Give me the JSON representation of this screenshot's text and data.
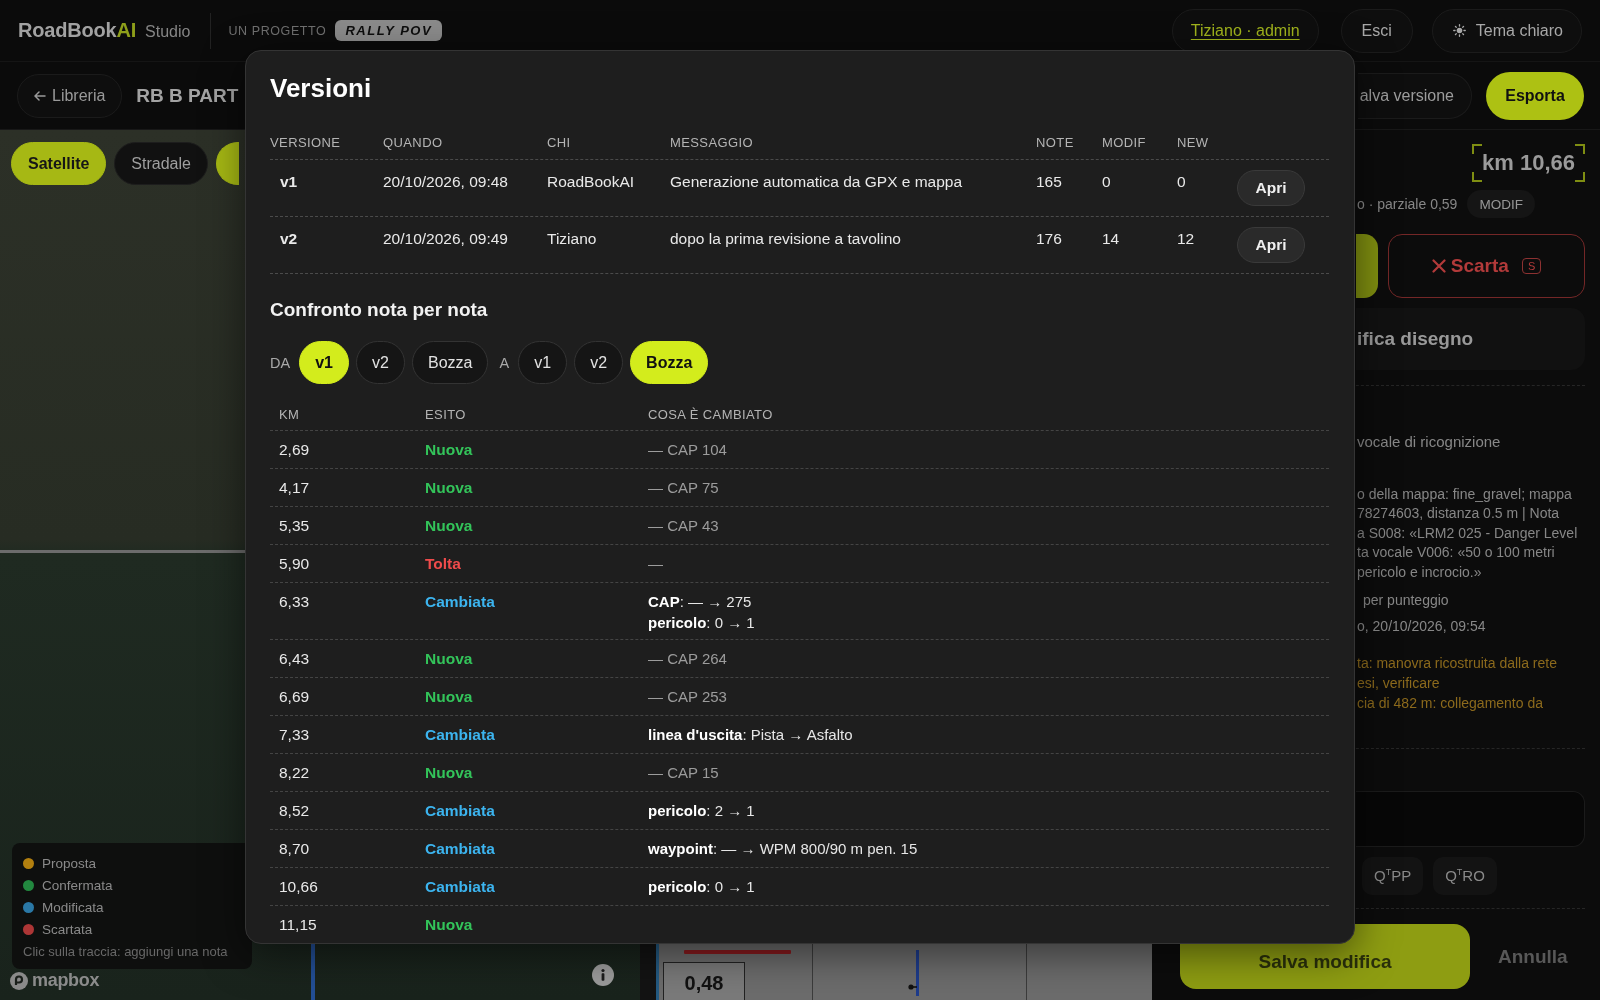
{
  "header": {
    "brand": {
      "name": "RoadBook",
      "accent": "AI",
      "product": "Studio"
    },
    "project_label": "UN PROGETTO",
    "partner_logo": "RALLY POV",
    "user_link": "Tiziano · admin",
    "logout_button": "Esci",
    "theme_button": "Tema chiaro"
  },
  "toolbar": {
    "back_button": "Libreria",
    "title": "RB B PART",
    "save_version_button": "alva versione",
    "export_button": "Esporta"
  },
  "map": {
    "layers": [
      {
        "label": "Satellite",
        "selected": true
      },
      {
        "label": "Stradale",
        "selected": false
      }
    ],
    "tool_button": {
      "active": true
    },
    "legend": [
      {
        "label": "Proposta",
        "color": "#b3800f"
      },
      {
        "label": "Confermata",
        "color": "#22883f"
      },
      {
        "label": "Modificata",
        "color": "#2a78a6"
      },
      {
        "label": "Scartata",
        "color": "#ad3636"
      }
    ],
    "legend_hint": "Clic sulla traccia: aggiungi una nota",
    "attribution": "mapbox"
  },
  "roadbook": {
    "distance": "0,48"
  },
  "note_panel": {
    "km": "km 10,66",
    "partial": "o · parziale 0,59",
    "status_badge": "MODIF",
    "discard_button": {
      "label": "Scarta",
      "shortcut": "S"
    },
    "edit_drawing_button": "ifica disegno",
    "source": "vocale di ricognizione",
    "description_lines": [
      "o della mappa: fine_gravel; mappa",
      "78274603, distanza 0.5 m | Nota",
      "a S008: «LRM2 025 - Danger Level",
      "ta vocale V006: «50 o 100 metri",
      "pericolo e incrocio.»"
    ],
    "score_note": "per punteggio",
    "timestamp": "o, 20/10/2026, 09:54",
    "warnings": [
      "ta: manovra ricostruita dalla rete",
      "esi, verificare",
      "cia di 482 m: collegamento da"
    ],
    "quick_buttons": [
      "Q$^{T}$PP",
      "Q$^{T}$RO"
    ],
    "save_button": "Salva modifica",
    "cancel_button": "Annulla"
  },
  "versions_dialog": {
    "title": "Versioni",
    "columns": [
      "VERSIONE",
      "QUANDO",
      "CHI",
      "MESSAGGIO",
      "NOTE",
      "MODIF",
      "NEW"
    ],
    "rows": [
      {
        "version": "v1",
        "when": "20/10/2026, 09:48",
        "who": "RoadBookAI",
        "message": "Generazione automatica da GPX e mappa",
        "notes": "165",
        "modified": "0",
        "new": "0",
        "action": "Apri"
      },
      {
        "version": "v2",
        "when": "20/10/2026, 09:49",
        "who": "Tiziano",
        "message": "dopo la prima revisione a tavolino",
        "notes": "176",
        "modified": "14",
        "new": "12",
        "action": "Apri"
      }
    ],
    "compare": {
      "title": "Confronto nota per nota",
      "from": {
        "label": "DA",
        "options": [
          {
            "label": "v1",
            "selected": true
          },
          {
            "label": "v2",
            "selected": false
          },
          {
            "label": "Bozza",
            "selected": false
          }
        ]
      },
      "to": {
        "label": "A",
        "options": [
          {
            "label": "v1",
            "selected": false
          },
          {
            "label": "v2",
            "selected": false
          },
          {
            "label": "Bozza",
            "selected": true
          }
        ]
      },
      "columns": [
        "KM",
        "ESITO",
        "COSA È CAMBIATO"
      ],
      "rows": [
        {
          "km": "2,69",
          "kind": "new",
          "outcome": "Nuova",
          "changes": [
            "— CAP 104"
          ]
        },
        {
          "km": "4,17",
          "kind": "new",
          "outcome": "Nuova",
          "changes": [
            "— CAP 75"
          ]
        },
        {
          "km": "5,35",
          "kind": "new",
          "outcome": "Nuova",
          "changes": [
            "— CAP 43"
          ]
        },
        {
          "km": "5,90",
          "kind": "removed",
          "outcome": "Tolta",
          "changes": [
            "—"
          ]
        },
        {
          "km": "6,33",
          "kind": "changed",
          "outcome": "Cambiata",
          "changes": [
            "**CAP**: — → 275",
            "**pericolo**: 0 → 1"
          ]
        },
        {
          "km": "6,43",
          "kind": "new",
          "outcome": "Nuova",
          "changes": [
            "— CAP 264"
          ]
        },
        {
          "km": "6,69",
          "kind": "new",
          "outcome": "Nuova",
          "changes": [
            "— CAP 253"
          ]
        },
        {
          "km": "7,33",
          "kind": "changed",
          "outcome": "Cambiata",
          "changes": [
            "**linea d'uscita**: Pista → Asfalto"
          ]
        },
        {
          "km": "8,22",
          "kind": "new",
          "outcome": "Nuova",
          "changes": [
            "— CAP 15"
          ]
        },
        {
          "km": "8,52",
          "kind": "changed",
          "outcome": "Cambiata",
          "changes": [
            "**pericolo**: 2 → 1"
          ]
        },
        {
          "km": "8,70",
          "kind": "changed",
          "outcome": "Cambiata",
          "changes": [
            "**waypoint**: — → WPM 800/90 m pen. 15"
          ]
        },
        {
          "km": "10,66",
          "kind": "changed",
          "outcome": "Cambiata",
          "changes": [
            "**pericolo**: 0 → 1"
          ]
        },
        {
          "km": "11,15",
          "kind": "new",
          "outcome": "Nuova"
        }
      ]
    }
  }
}
